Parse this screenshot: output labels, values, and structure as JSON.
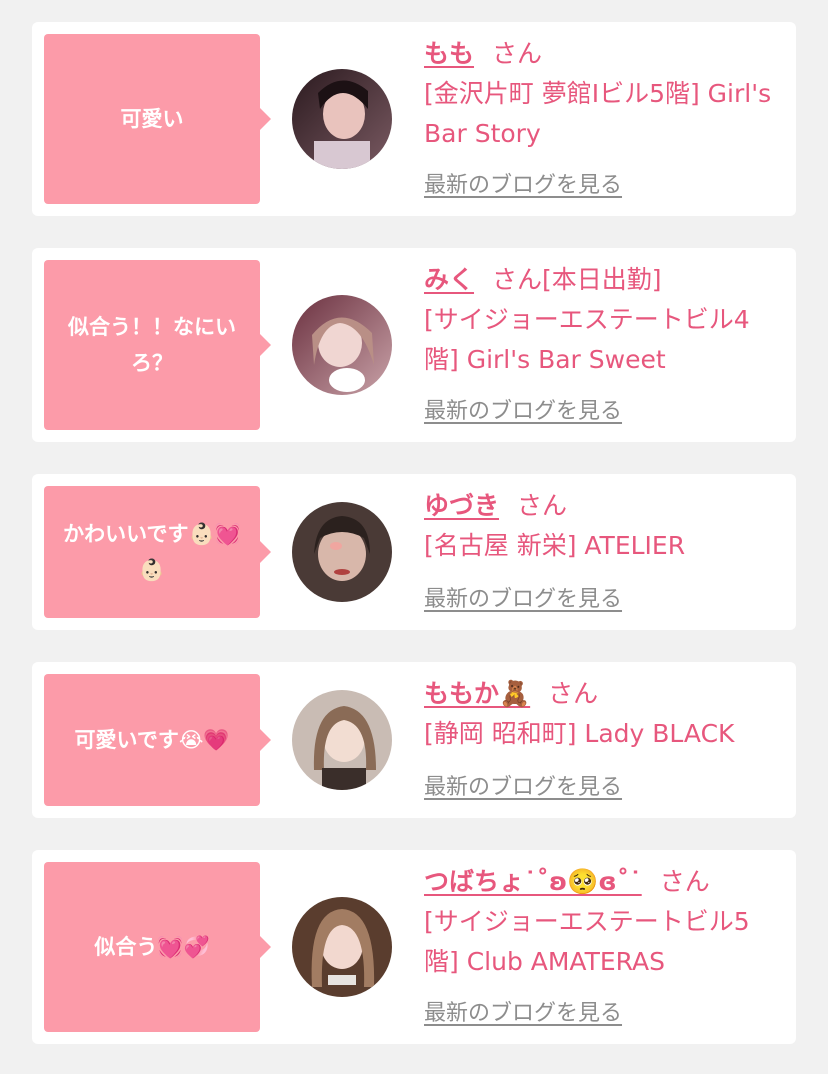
{
  "posts": [
    {
      "comment": "可愛い",
      "name": "もも",
      "honorific": "さん",
      "shop": "[金沢片町 夢館Ⅰビル5階] Girl's Bar Story",
      "blog_link": "最新のブログを見る"
    },
    {
      "comment": "似合う！！なにいろ？",
      "name": "みく",
      "honorific": "さん[本日出勤]",
      "shop": "[サイジョーエステートビル4階] Girl's Bar Sweet",
      "blog_link": "最新のブログを見る"
    },
    {
      "comment": "かわいいです👶🏻💓👶🏻",
      "name": "ゆづき",
      "honorific": "さん",
      "shop": "[名古屋 新栄] ATELIER",
      "blog_link": "最新のブログを見る"
    },
    {
      "comment": "可愛いです😭💗",
      "name": "ももか🧸",
      "honorific": "さん",
      "shop": "[静岡 昭和町] Lady BLACK",
      "blog_link": "最新のブログを見る"
    },
    {
      "comment": "似合う💓💞",
      "name": "つばちょ˙˚ʚ🥺ɞ˚˙",
      "honorific": "さん",
      "shop": "[サイジョーエステートビル5階] Club AMATERAS",
      "blog_link": "最新のブログを見る"
    }
  ],
  "colors": {
    "bubble": "#fc9ba9",
    "name": "#e7577d",
    "link": "#8d8d8d",
    "background": "#f1f1f1"
  }
}
